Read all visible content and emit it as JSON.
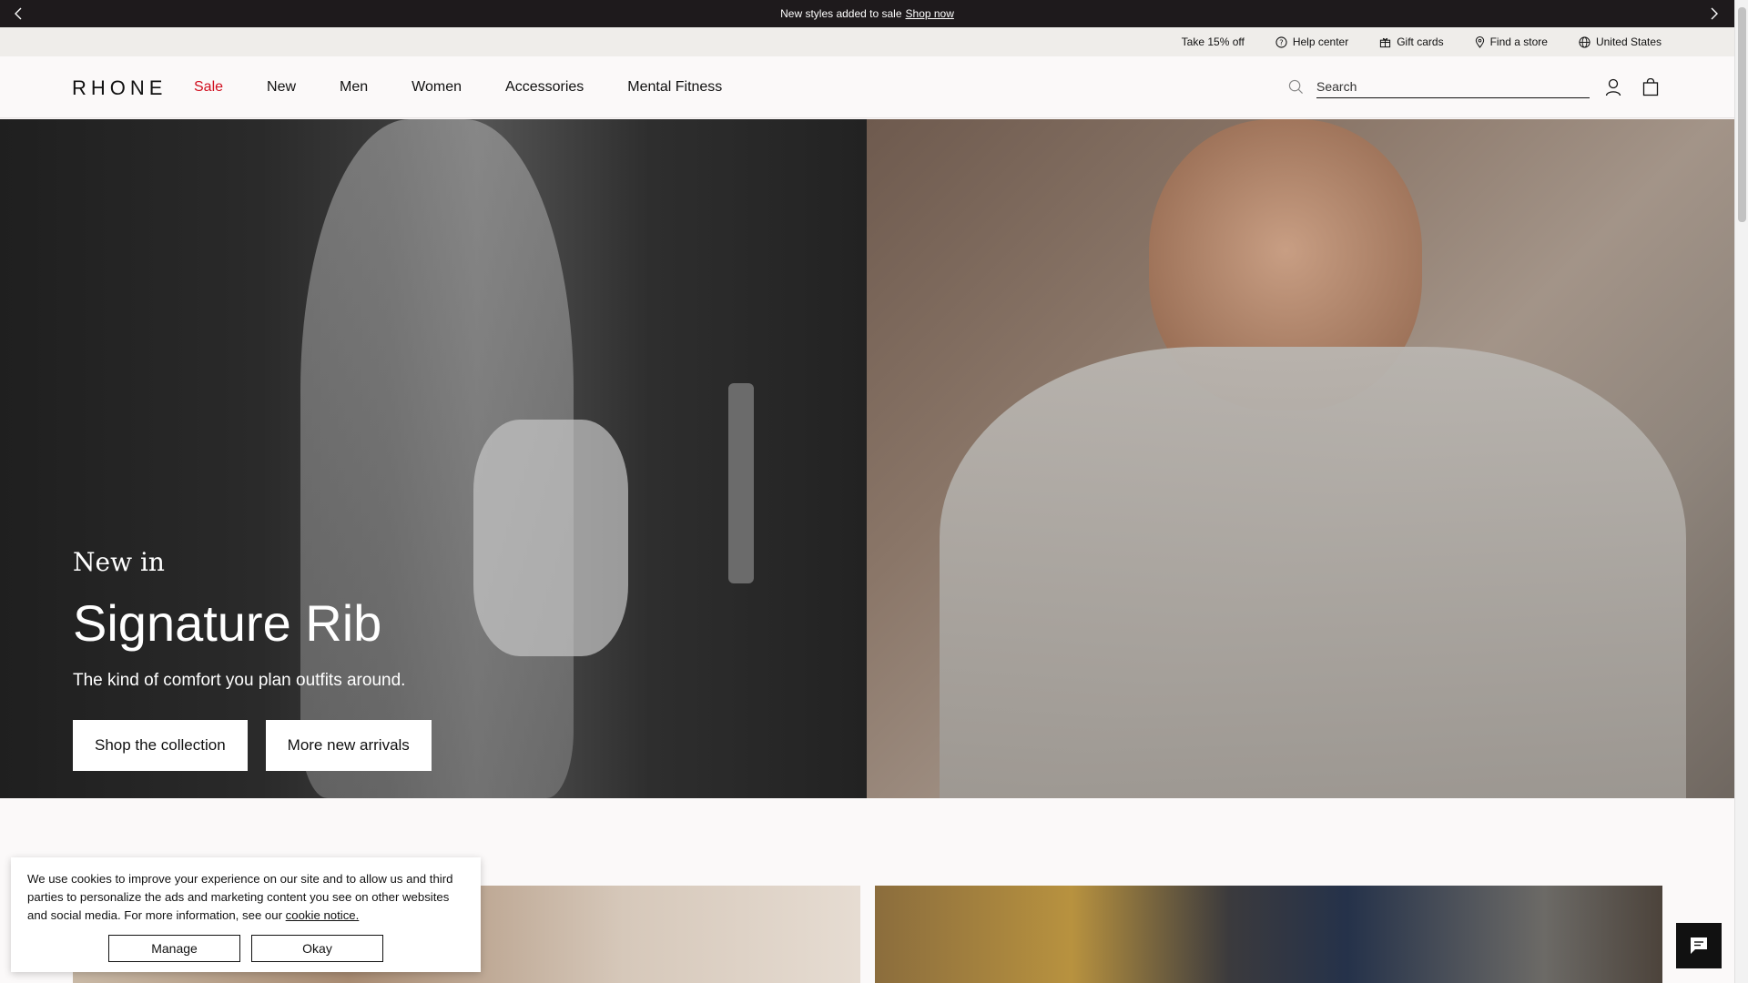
{
  "announcement": {
    "text": "New styles added to sale",
    "link": "Shop now"
  },
  "utility": {
    "items": [
      {
        "label": "Take 15% off",
        "icon": "none"
      },
      {
        "label": "Help center",
        "icon": "help-icon"
      },
      {
        "label": "Gift cards",
        "icon": "gift-icon"
      },
      {
        "label": "Find a store",
        "icon": "location-pin-icon"
      },
      {
        "label": "United States",
        "icon": "globe-icon"
      }
    ]
  },
  "header": {
    "logo": "RHONE",
    "nav": [
      "Sale",
      "New",
      "Men",
      "Women",
      "Accessories",
      "Mental Fitness"
    ],
    "search_placeholder": "Search"
  },
  "hero": {
    "eyebrow": "New in",
    "title": "Signature Rib",
    "subtitle": "The kind of comfort you plan outfits around.",
    "buttons": [
      "Shop the collection",
      "More new arrivals"
    ]
  },
  "cookie": {
    "text": "We use cookies to improve your experience on our site and to allow us and third parties to personalize the ads and marketing content you see on other websites and social media. For more information, see our",
    "link": "cookie notice.",
    "manage": "Manage",
    "okay": "Okay"
  },
  "colors": {
    "announce_bg": "#1e1a1c",
    "utility_bg": "#efedea",
    "sale_red": "#d10f1f",
    "page_bg": "#fbf9f9"
  }
}
